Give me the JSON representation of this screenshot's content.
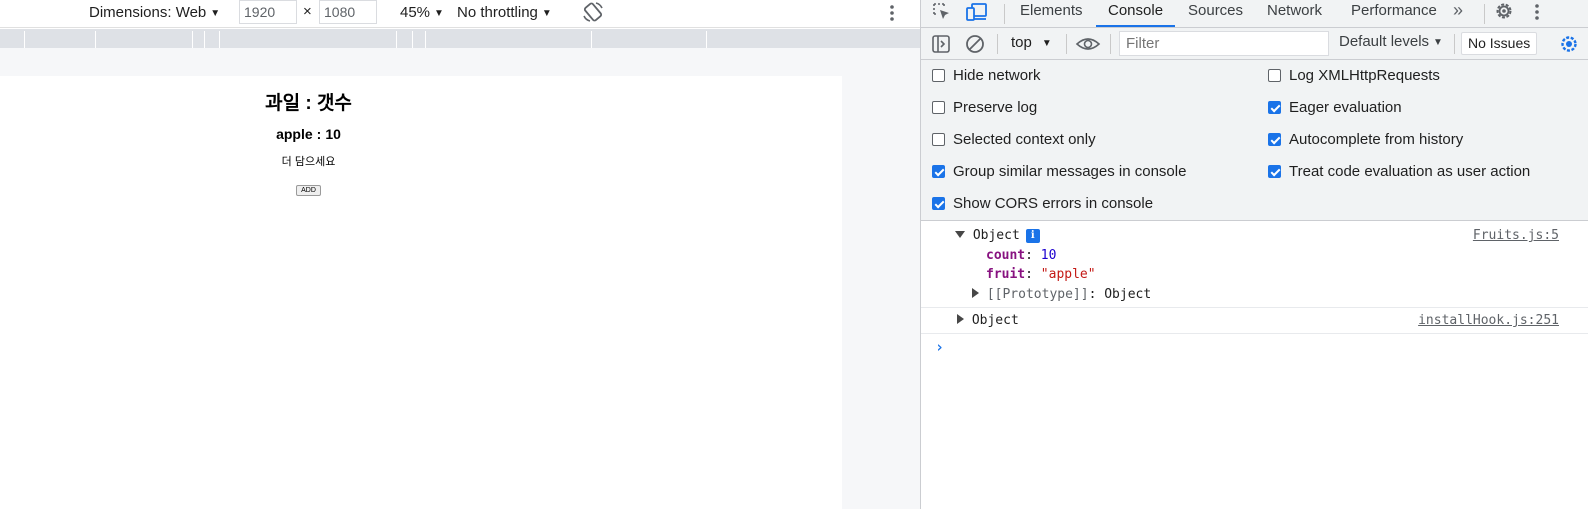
{
  "device_toolbar": {
    "dimensions_label": "Dimensions: Web",
    "width_value": "1920",
    "times": "×",
    "height_value": "1080",
    "zoom": "45%",
    "throttling": "No throttling"
  },
  "page": {
    "title": "과일 : 갯수",
    "fruit": "apple",
    "separator": ":",
    "count": "10",
    "prompt_text": "더 담으세요",
    "add_button": "ADD"
  },
  "devtools": {
    "tabs": [
      "Elements",
      "Console",
      "Sources",
      "Network",
      "Performance"
    ],
    "active_tab": "Console",
    "more_tabs": "»",
    "accent": "#1a73e8"
  },
  "console_toolbar": {
    "context": "top",
    "filter_placeholder": "Filter",
    "levels": "Default levels",
    "issues": "No Issues"
  },
  "settings": {
    "left": [
      {
        "label": "Hide network",
        "checked": false
      },
      {
        "label": "Preserve log",
        "checked": false
      },
      {
        "label": "Selected context only",
        "checked": false
      },
      {
        "label": "Group similar messages in console",
        "checked": true
      },
      {
        "label": "Show CORS errors in console",
        "checked": true
      }
    ],
    "right": [
      {
        "label": "Log XMLHttpRequests",
        "checked": false
      },
      {
        "label": "Eager evaluation",
        "checked": true
      },
      {
        "label": "Autocomplete from history",
        "checked": true
      },
      {
        "label": "Treat code evaluation as user action",
        "checked": true
      }
    ]
  },
  "console": {
    "messages": [
      {
        "summary": "Object",
        "source": "Fruits.js:5",
        "info": "i",
        "props": [
          {
            "name": "count",
            "value": "10"
          },
          {
            "name": "fruit",
            "value": "\"apple\""
          }
        ],
        "proto_name": "[[Prototype]]",
        "proto_value": "Object"
      },
      {
        "summary": "Object",
        "source": "installHook.js:251"
      }
    ],
    "prompt": "›"
  }
}
